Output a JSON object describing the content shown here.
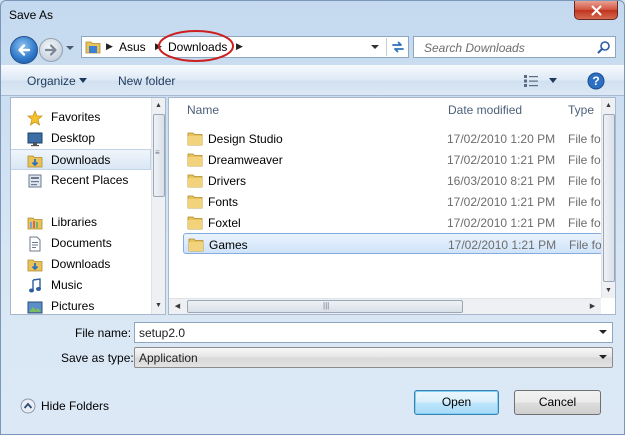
{
  "window": {
    "title": "Save As"
  },
  "address": {
    "crumbs": [
      "Asus",
      "Downloads"
    ],
    "highlight_color": "#cc1f1f"
  },
  "search": {
    "placeholder": "Search Downloads"
  },
  "toolbar": {
    "organize_label": "Organize",
    "new_folder_label": "New folder"
  },
  "sidebar": {
    "favorites": {
      "label": "Favorites",
      "icon": "star-icon"
    },
    "favorite_items": [
      {
        "label": "Desktop",
        "icon": "desktop-icon"
      },
      {
        "label": "Downloads",
        "icon": "downloads-folder-icon",
        "selected": true
      },
      {
        "label": "Recent Places",
        "icon": "recent-places-icon"
      }
    ],
    "libraries": {
      "label": "Libraries",
      "icon": "libraries-icon"
    },
    "library_items": [
      {
        "label": "Documents",
        "icon": "documents-icon"
      },
      {
        "label": "Downloads",
        "icon": "downloads-folder-icon"
      },
      {
        "label": "Music",
        "icon": "music-icon"
      },
      {
        "label": "Pictures",
        "icon": "pictures-icon"
      }
    ]
  },
  "filelist": {
    "columns": [
      "Name",
      "Date modified",
      "Type"
    ],
    "rows": [
      {
        "name": "Design Studio",
        "date": "17/02/2010 1:20 PM",
        "type": "File folder",
        "icon": "folder-icon"
      },
      {
        "name": "Dreamweaver",
        "date": "17/02/2010 1:21 PM",
        "type": "File folder",
        "icon": "folder-icon"
      },
      {
        "name": "Drivers",
        "date": "16/03/2010 8:21 PM",
        "type": "File folder",
        "icon": "folder-icon"
      },
      {
        "name": "Fonts",
        "date": "17/02/2010 1:21 PM",
        "type": "File folder",
        "icon": "folder-icon"
      },
      {
        "name": "Foxtel",
        "date": "17/02/2010 1:21 PM",
        "type": "File folder",
        "icon": "folder-icon"
      },
      {
        "name": "Games",
        "date": "17/02/2010 1:21 PM",
        "type": "File folder",
        "icon": "folder-icon",
        "selected": true
      }
    ]
  },
  "form": {
    "file_name_label": "File name:",
    "file_name_value": "setup2.0",
    "save_type_label": "Save as type:",
    "save_type_value": "Application"
  },
  "footer": {
    "hide_folders_label": "Hide Folders",
    "open_label": "Open",
    "cancel_label": "Cancel"
  }
}
